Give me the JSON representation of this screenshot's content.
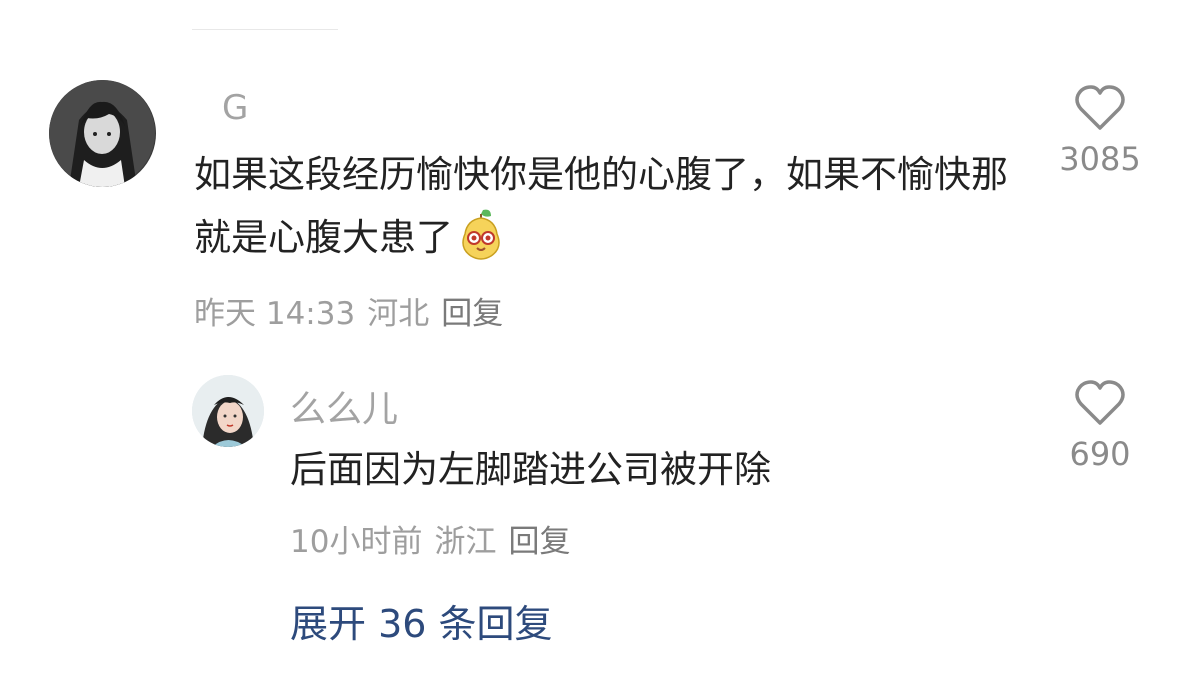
{
  "comment": {
    "username": "G",
    "text": "如果这段经历愉快你是他的心腹了，如果不愉快那就是心腹大患了",
    "time": "昨天 14:33",
    "location": "河北",
    "reply_label": "回复",
    "likes": "3085",
    "avatar_icon": "anime-character-avatar",
    "emoji_icon": "pear-emoji-icon"
  },
  "reply": {
    "username": "么么儿",
    "text": "后面因为左脚踏进公司被开除",
    "time": "10小时前",
    "location": "浙江",
    "reply_label": "回复",
    "likes": "690",
    "avatar_icon": "woman-portrait-avatar"
  },
  "expand_label": "展开 36 条回复",
  "colors": {
    "text": "#222222",
    "meta": "#9e9e9e",
    "link": "#2d4a7c",
    "username": "#a3a3a3"
  }
}
